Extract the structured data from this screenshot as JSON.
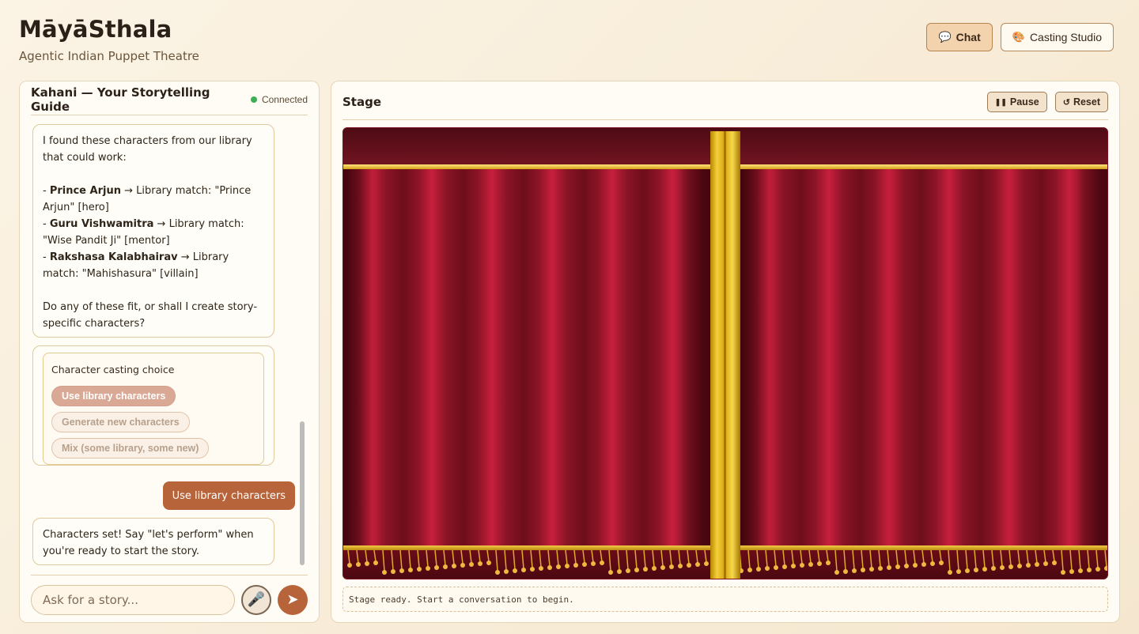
{
  "header": {
    "brand": "MāyāSthala",
    "tagline": "Agentic Indian Puppet Theatre"
  },
  "nav": {
    "chat": {
      "icon": "💬",
      "label": "Chat"
    },
    "casting": {
      "icon": "🎨",
      "label": "Casting Studio"
    }
  },
  "chat": {
    "title": "Kahani — Your Storytelling Guide",
    "status": "Connected",
    "status_color": "#3fae53",
    "messages": {
      "m1": {
        "intro": "I found these characters from our library that could work:",
        "items": [
          {
            "name": "Prince Arjun",
            "arrow": " → Library match: ",
            "match": "\"Prince Arjun\" [hero]"
          },
          {
            "name": "Guru Vishwamitra",
            "arrow": " → Library match: ",
            "match": "\"Wise Pandit Ji\" [mentor]"
          },
          {
            "name": "Rakshasa Kalabhairav",
            "arrow": " → Library match: ",
            "match": "\"Mahishasura\" [villain]"
          }
        ],
        "question": "Do any of these fit, or shall I create story-specific characters?"
      },
      "choice": {
        "label": "Character casting choice",
        "options": [
          "Use library characters",
          "Generate new characters",
          "Mix (some library, some new)"
        ]
      },
      "user_reply": "Use library characters",
      "m3": "Characters set! Say \"let's perform\" when you're ready to start the story."
    },
    "composer": {
      "placeholder": "Ask for a story...",
      "mic_icon": "🎤",
      "send_icon": "➤"
    }
  },
  "stage": {
    "title": "Stage",
    "pause": {
      "icon": "❚❚",
      "label": "Pause"
    },
    "reset": {
      "icon": "↺",
      "label": "Reset"
    },
    "status": "Stage ready. Start a conversation to begin."
  },
  "colors": {
    "accent": "#b8643a",
    "curtain": "#c81f3d",
    "gold": "#f4cf3a"
  }
}
